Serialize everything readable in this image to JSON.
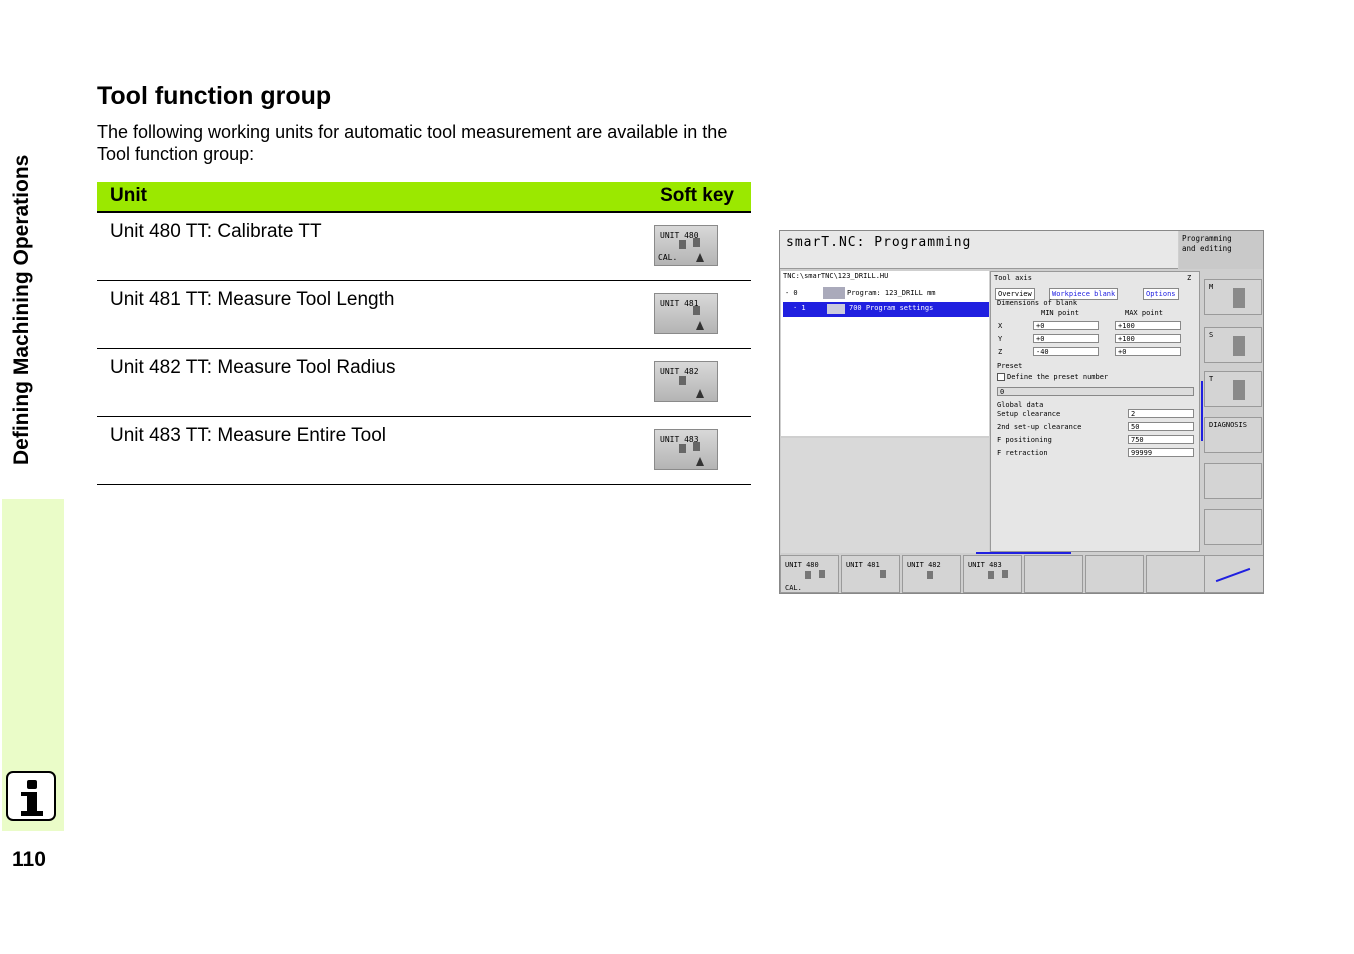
{
  "sidebar": {
    "title": "Defining Machining Operations",
    "icon": "info-icon"
  },
  "page_number": "110",
  "heading": "Tool function group",
  "intro": "The following working units for automatic tool measurement are available in the Tool function group:",
  "table": {
    "headers": {
      "unit": "Unit",
      "softkey": "Soft key"
    },
    "header_color": "#9be800",
    "rows": [
      {
        "label": "Unit 480 TT: Calibrate TT",
        "key_top": "UNIT 480",
        "key_bottom": "CAL."
      },
      {
        "label": "Unit 481 TT: Measure Tool Length",
        "key_top": "UNIT 481",
        "key_bottom": ""
      },
      {
        "label": "Unit 482 TT: Measure Tool Radius",
        "key_top": "UNIT 482",
        "key_bottom": ""
      },
      {
        "label": "Unit 483 TT: Measure Entire Tool",
        "key_top": "UNIT 483",
        "key_bottom": ""
      }
    ]
  },
  "screen": {
    "title": "smarT.NC: Programming",
    "mode": "Programming\nand editing",
    "path": "TNC:\\smarTNC\\123_DRILL.HU",
    "tree": [
      {
        "index": "- 0",
        "text": "Program: 123_DRILL mm"
      },
      {
        "index": "· 1",
        "text": "700 Program settings"
      }
    ],
    "form": {
      "header_left": "Tool axis",
      "header_right": "Z",
      "tabs": [
        "Overview",
        "Workpiece blank",
        "Options"
      ],
      "dimensions_label": "Dimensions of blank",
      "min_label": "MIN point",
      "max_label": "MAX point",
      "axes": [
        {
          "axis": "X",
          "min": "+0",
          "max": "+100"
        },
        {
          "axis": "Y",
          "min": "+0",
          "max": "+100"
        },
        {
          "axis": "Z",
          "min": "-40",
          "max": "+0"
        }
      ],
      "preset_label": "Preset",
      "preset_checkbox": "Define the preset number",
      "preset_value": "0",
      "global_label": "Global data",
      "global": [
        {
          "label": "Setup clearance",
          "value": "2"
        },
        {
          "label": "2nd set-up clearance",
          "value": "50"
        },
        {
          "label": "F positioning",
          "value": "750"
        },
        {
          "label": "F retraction",
          "value": "99999"
        }
      ]
    },
    "side_keys": [
      "M",
      "S",
      "T",
      "DIAGNOSIS",
      "",
      ""
    ],
    "bottom_keys": [
      {
        "top": "UNIT 480",
        "bottom": "CAL."
      },
      {
        "top": "UNIT 481",
        "bottom": ""
      },
      {
        "top": "UNIT 482",
        "bottom": ""
      },
      {
        "top": "UNIT 483",
        "bottom": ""
      },
      {
        "top": "",
        "bottom": ""
      },
      {
        "top": "",
        "bottom": ""
      },
      {
        "top": "",
        "bottom": ""
      }
    ]
  }
}
